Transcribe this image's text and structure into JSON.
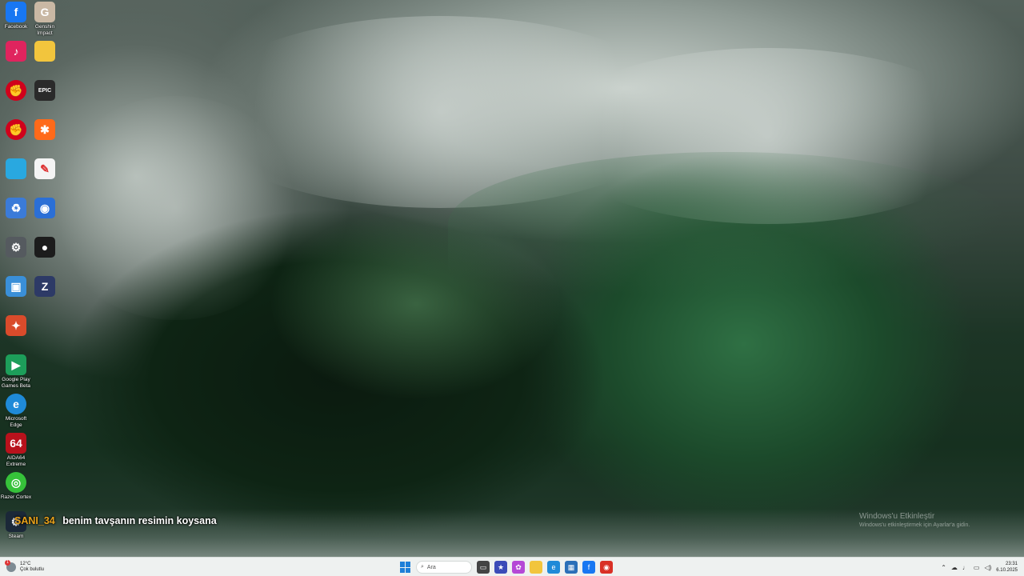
{
  "desktop_icons": [
    {
      "label": "Facebook",
      "glyph": "f",
      "color": "#1877f2",
      "icon": "facebook-icon"
    },
    {
      "label": "Genshin Impact",
      "glyph": "G",
      "color": "#c9b8a4",
      "icon": "genshin-icon"
    },
    {
      "label": "",
      "glyph": "♪",
      "color": "#e0245e",
      "icon": "app-icon"
    },
    {
      "label": "",
      "glyph": "",
      "color": "#f2c53d",
      "icon": "folder-icon"
    },
    {
      "label": "",
      "glyph": "✊",
      "color": "#d0021b",
      "icon": "riot-icon"
    },
    {
      "label": "",
      "glyph": "EPIC",
      "color": "#2a2a2a",
      "icon": "epic-games-icon"
    },
    {
      "label": "",
      "glyph": "✊",
      "color": "#d0021b",
      "icon": "riot-icon-2"
    },
    {
      "label": "",
      "glyph": "✱",
      "color": "#ff6a1a",
      "icon": "app-icon-2"
    },
    {
      "label": "",
      "glyph": "",
      "color": "#29a8e0",
      "icon": "app-icon-3"
    },
    {
      "label": "",
      "glyph": "✎",
      "color": "#f4f4f4",
      "icon": "app-icon-4"
    },
    {
      "label": "",
      "glyph": "♻",
      "color": "#3b7bd8",
      "icon": "recycle-bin-icon"
    },
    {
      "label": "",
      "glyph": "◉",
      "color": "#2b6fd6",
      "icon": "app-icon-5"
    },
    {
      "label": "",
      "glyph": "⚙",
      "color": "#555a5f",
      "icon": "app-icon-6"
    },
    {
      "label": "",
      "glyph": "●",
      "color": "#1c1c1c",
      "icon": "app-icon-7"
    },
    {
      "label": "",
      "glyph": "▣",
      "color": "#3a8fd8",
      "icon": "app-icon-8"
    },
    {
      "label": "",
      "glyph": "Z",
      "color": "#2d3a66",
      "icon": "app-icon-9"
    },
    {
      "label": "",
      "glyph": "✦",
      "color": "#d94b2b",
      "icon": "app-icon-10"
    },
    {
      "label": "Google Play Games Beta",
      "glyph": "▶",
      "color": "#1d9e5a",
      "icon": "google-play-games-icon"
    },
    {
      "label": "Microsoft Edge",
      "glyph": "e",
      "color": "#1f8ad8",
      "icon": "edge-icon"
    },
    {
      "label": "AIDA64 Extreme",
      "glyph": "64",
      "color": "#b8121c",
      "icon": "aida64-icon"
    },
    {
      "label": "Razer Cortex",
      "glyph": "◎",
      "color": "#36c23a",
      "icon": "razer-cortex-icon"
    },
    {
      "label": "Steam",
      "glyph": "⚙",
      "color": "#1b2838",
      "icon": "steam-icon"
    }
  ],
  "chat": {
    "username": "SANI_34",
    "message": "benim tavşanın resimin koysana"
  },
  "activation": {
    "title": "Windows'u Etkinleştir",
    "subtitle": "Windows'u etkinleştirmek için Ayarlar'a gidin."
  },
  "taskbar": {
    "weather_temp": "12°C",
    "weather_desc": "Çok bulutlu",
    "weather_badge": "1",
    "search_placeholder": "Ara",
    "pinned": [
      {
        "name": "task-view-icon",
        "glyph": "▭",
        "color": "#444"
      },
      {
        "name": "game-app-icon",
        "glyph": "★",
        "color": "#3b4bb8"
      },
      {
        "name": "copilot-icon",
        "glyph": "✿",
        "color": "#b548d6"
      },
      {
        "name": "file-explorer-icon",
        "glyph": "",
        "color": "#f2c53d"
      },
      {
        "name": "edge-taskbar-icon",
        "glyph": "e",
        "color": "#1f8ad8"
      },
      {
        "name": "store-icon",
        "glyph": "▦",
        "color": "#2a6fb8"
      },
      {
        "name": "facebook-taskbar-icon",
        "glyph": "f",
        "color": "#1877f2"
      },
      {
        "name": "chrome-icon",
        "glyph": "◉",
        "color": "#d93025"
      }
    ],
    "time": "23:31",
    "date": "6.10.2025"
  }
}
